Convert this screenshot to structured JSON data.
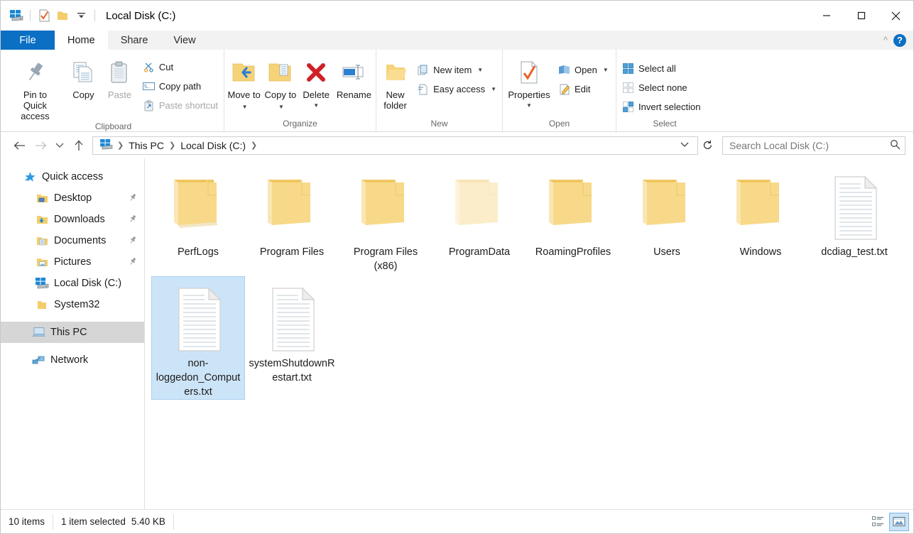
{
  "window": {
    "title": "Local Disk (C:)",
    "quick_access_icons": [
      "this-pc-icon",
      "properties-checkmark-icon",
      "new-folder-icon",
      "customize-qat-caret-icon"
    ],
    "caption": {
      "minimize": "minimize-icon",
      "maximize": "maximize-icon",
      "close": "close-icon"
    }
  },
  "ribbon": {
    "tabs": [
      {
        "label": "File",
        "kind": "file"
      },
      {
        "label": "Home",
        "kind": "active"
      },
      {
        "label": "Share",
        "kind": "normal"
      },
      {
        "label": "View",
        "kind": "normal"
      }
    ],
    "collapse_label": "^",
    "help_label": "?",
    "groups": [
      {
        "label": "Clipboard",
        "big": [
          {
            "label": "Pin to Quick access",
            "icon": "pin-icon",
            "disabled": false
          },
          {
            "label": "Copy",
            "icon": "copy-icon",
            "disabled": false
          },
          {
            "label": "Paste",
            "icon": "paste-icon",
            "disabled": true
          }
        ],
        "small": [
          {
            "label": "Cut",
            "icon": "scissors-icon",
            "disabled": false,
            "caret": false
          },
          {
            "label": "Copy path",
            "icon": "copy-path-icon",
            "disabled": false,
            "caret": false
          },
          {
            "label": "Paste shortcut",
            "icon": "paste-shortcut-icon",
            "disabled": true,
            "caret": false
          }
        ]
      },
      {
        "label": "Organize",
        "big": [
          {
            "label": "Move to",
            "icon": "move-to-icon",
            "disabled": false,
            "caret": true
          },
          {
            "label": "Copy to",
            "icon": "copy-to-icon",
            "disabled": false,
            "caret": true
          },
          {
            "label": "Delete",
            "icon": "delete-icon",
            "disabled": false,
            "caret": true
          },
          {
            "label": "Rename",
            "icon": "rename-icon",
            "disabled": false,
            "caret": false
          }
        ],
        "small": []
      },
      {
        "label": "New",
        "big": [
          {
            "label": "New folder",
            "icon": "new-folder-icon",
            "disabled": false
          }
        ],
        "small": [
          {
            "label": "New item",
            "icon": "new-item-icon",
            "disabled": false,
            "caret": true
          },
          {
            "label": "Easy access",
            "icon": "easy-access-icon",
            "disabled": false,
            "caret": true
          }
        ]
      },
      {
        "label": "Open",
        "big": [
          {
            "label": "Properties",
            "icon": "properties-icon",
            "disabled": false,
            "caret": true
          }
        ],
        "small": [
          {
            "label": "Open",
            "icon": "open-icon",
            "disabled": false,
            "caret": true
          },
          {
            "label": "Edit",
            "icon": "edit-icon",
            "disabled": false,
            "caret": false
          }
        ]
      },
      {
        "label": "Select",
        "big": [],
        "small": [
          {
            "label": "Select all",
            "icon": "select-all-icon",
            "disabled": false,
            "caret": false
          },
          {
            "label": "Select none",
            "icon": "select-none-icon",
            "disabled": false,
            "caret": false
          },
          {
            "label": "Invert selection",
            "icon": "invert-selection-icon",
            "disabled": false,
            "caret": false
          }
        ]
      }
    ]
  },
  "address": {
    "back_icon": "back-arrow-icon",
    "forward_icon": "forward-arrow-icon",
    "recent_icon": "recent-locations-caret-icon",
    "up_icon": "up-arrow-icon",
    "root_icon": "this-pc-icon",
    "crumbs": [
      "This PC",
      "Local Disk (C:)"
    ],
    "dropdown_icon": "address-dropdown-icon",
    "refresh_icon": "refresh-icon"
  },
  "search": {
    "placeholder": "Search Local Disk (C:)",
    "icon": "search-icon"
  },
  "navpane": {
    "items": [
      {
        "label": "Quick access",
        "icon": "quick-access-star-icon",
        "indent": "lvl0",
        "pinned": false,
        "selected": false
      },
      {
        "label": "Desktop",
        "icon": "desktop-folder-icon",
        "indent": "lvl1",
        "pinned": true,
        "selected": false
      },
      {
        "label": "Downloads",
        "icon": "downloads-folder-icon",
        "indent": "lvl1",
        "pinned": true,
        "selected": false
      },
      {
        "label": "Documents",
        "icon": "documents-folder-icon",
        "indent": "lvl1",
        "pinned": true,
        "selected": false
      },
      {
        "label": "Pictures",
        "icon": "pictures-folder-icon",
        "indent": "lvl1",
        "pinned": true,
        "selected": false
      },
      {
        "label": "Local Disk (C:)",
        "icon": "local-disk-icon",
        "indent": "lvl1",
        "pinned": false,
        "selected": false
      },
      {
        "label": "System32",
        "icon": "folder-icon",
        "indent": "lvl1",
        "pinned": false,
        "selected": false
      },
      {
        "label": "This PC",
        "icon": "this-pc-monitor-icon",
        "indent": "lvl-root",
        "pinned": false,
        "selected": true,
        "gap_before": true
      },
      {
        "label": "Network",
        "icon": "network-icon",
        "indent": "lvl-root",
        "pinned": false,
        "selected": false,
        "gap_before": true
      }
    ]
  },
  "files": {
    "items": [
      {
        "name": "PerfLogs",
        "type": "folder",
        "dim": false,
        "selected": false
      },
      {
        "name": "Program Files",
        "type": "folder",
        "dim": false,
        "selected": false
      },
      {
        "name": "Program Files (x86)",
        "type": "folder",
        "dim": false,
        "selected": false
      },
      {
        "name": "ProgramData",
        "type": "folder",
        "dim": true,
        "selected": false
      },
      {
        "name": "RoamingProfiles",
        "type": "folder",
        "dim": false,
        "selected": false
      },
      {
        "name": "Users",
        "type": "folder",
        "dim": false,
        "selected": false
      },
      {
        "name": "Windows",
        "type": "folder",
        "dim": false,
        "selected": false
      },
      {
        "name": "dcdiag_test.txt",
        "type": "textfile",
        "dim": false,
        "selected": false
      },
      {
        "name": "non-loggedon_Computers.txt",
        "type": "textfile",
        "dim": false,
        "selected": true
      },
      {
        "name": "systemShutdownRestart.txt",
        "type": "textfile",
        "dim": false,
        "selected": false
      }
    ]
  },
  "statusbar": {
    "item_count": "10 items",
    "selection": "1 item selected",
    "size": "5.40 KB",
    "views": [
      {
        "name": "details-view-icon",
        "active": false
      },
      {
        "name": "large-icons-view-icon",
        "active": true
      }
    ]
  },
  "colors": {
    "accent": "#0b6fc4",
    "selection": "#cce4f7",
    "folder": "#f4cd6a",
    "navpane_selected": "#d6d6d6"
  }
}
